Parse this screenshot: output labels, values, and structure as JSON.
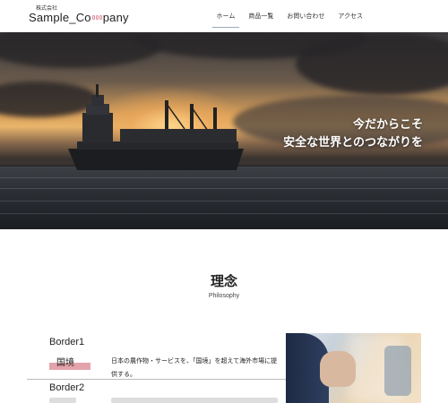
{
  "header": {
    "logo_sub": "株式会社",
    "logo_left": "Sample_Co",
    "logo_right": "pany",
    "nav": [
      {
        "label": "ホーム",
        "active": true
      },
      {
        "label": "商品一覧",
        "active": false
      },
      {
        "label": "お問い合わせ",
        "active": false
      },
      {
        "label": "アクセス",
        "active": false
      }
    ]
  },
  "hero": {
    "line1": "今だからこそ",
    "line2": "安全な世界とのつながりを"
  },
  "philosophy": {
    "title": "理念",
    "subtitle": "Philosophy"
  },
  "borders": [
    {
      "title": "Border1",
      "tag": "国境",
      "text": "日本の農作物・サービスを、「国境」を超えて海外市場に提供する。"
    },
    {
      "title": "Border2"
    }
  ],
  "colors": {
    "accent_pink": "#e3a3aa",
    "nav_underline": "#99aabb"
  }
}
